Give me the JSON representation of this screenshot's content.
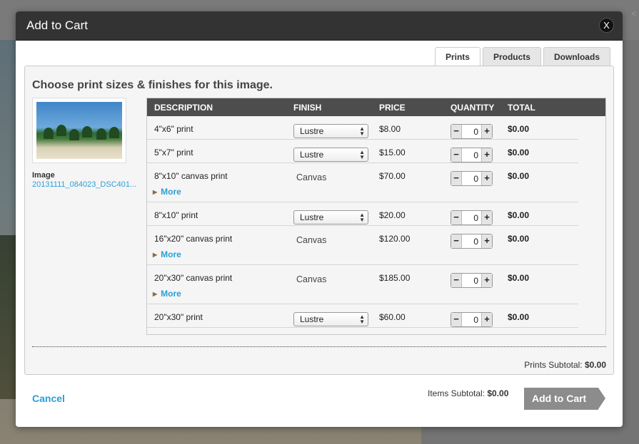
{
  "modal": {
    "title": "Add to Cart",
    "close_label": "X",
    "tabs": [
      {
        "label": "Prints",
        "active": true
      },
      {
        "label": "Products",
        "active": false
      },
      {
        "label": "Downloads",
        "active": false
      }
    ],
    "heading": "Choose print sizes & finishes for this image.",
    "image": {
      "label": "Image",
      "filename": "20131111_084023_DSC401..."
    },
    "columns": {
      "description": "DESCRIPTION",
      "finish": "FINISH",
      "price": "PRICE",
      "quantity": "QUANTITY",
      "total": "TOTAL"
    },
    "rows": [
      {
        "description": "4\"x6\" print",
        "finish": "Lustre",
        "finish_type": "select",
        "price": "$8.00",
        "quantity": "0",
        "total": "$0.00",
        "more": null
      },
      {
        "description": "5\"x7\" print",
        "finish": "Lustre",
        "finish_type": "select",
        "price": "$15.00",
        "quantity": "0",
        "total": "$0.00",
        "more": null
      },
      {
        "description": "8\"x10\" canvas print",
        "finish": "Canvas",
        "finish_type": "text",
        "price": "$70.00",
        "quantity": "0",
        "total": "$0.00",
        "more": "More"
      },
      {
        "description": "8\"x10\" print",
        "finish": "Lustre",
        "finish_type": "select",
        "price": "$20.00",
        "quantity": "0",
        "total": "$0.00",
        "more": null
      },
      {
        "description": "16\"x20\" canvas print",
        "finish": "Canvas",
        "finish_type": "text",
        "price": "$120.00",
        "quantity": "0",
        "total": "$0.00",
        "more": "More"
      },
      {
        "description": "20\"x30\" canvas print",
        "finish": "Canvas",
        "finish_type": "text",
        "price": "$185.00",
        "quantity": "0",
        "total": "$0.00",
        "more": "More"
      },
      {
        "description": "20\"x30\" print",
        "finish": "Lustre",
        "finish_type": "select",
        "price": "$60.00",
        "quantity": "0",
        "total": "$0.00",
        "more": null
      }
    ],
    "qty_minus": "−",
    "qty_plus": "+",
    "prints_subtotal_label": "Prints Subtotal: ",
    "prints_subtotal_value": "$0.00",
    "cancel_label": "Cancel",
    "items_subtotal_label": "Items Subtotal: ",
    "items_subtotal_value": "$0.00",
    "add_to_cart_label": "Add to Cart"
  },
  "colors": {
    "header_bg": "#333333",
    "link": "#2a9fd6",
    "add_button": "#8c8c8c",
    "table_header": "#4d4d4d"
  }
}
